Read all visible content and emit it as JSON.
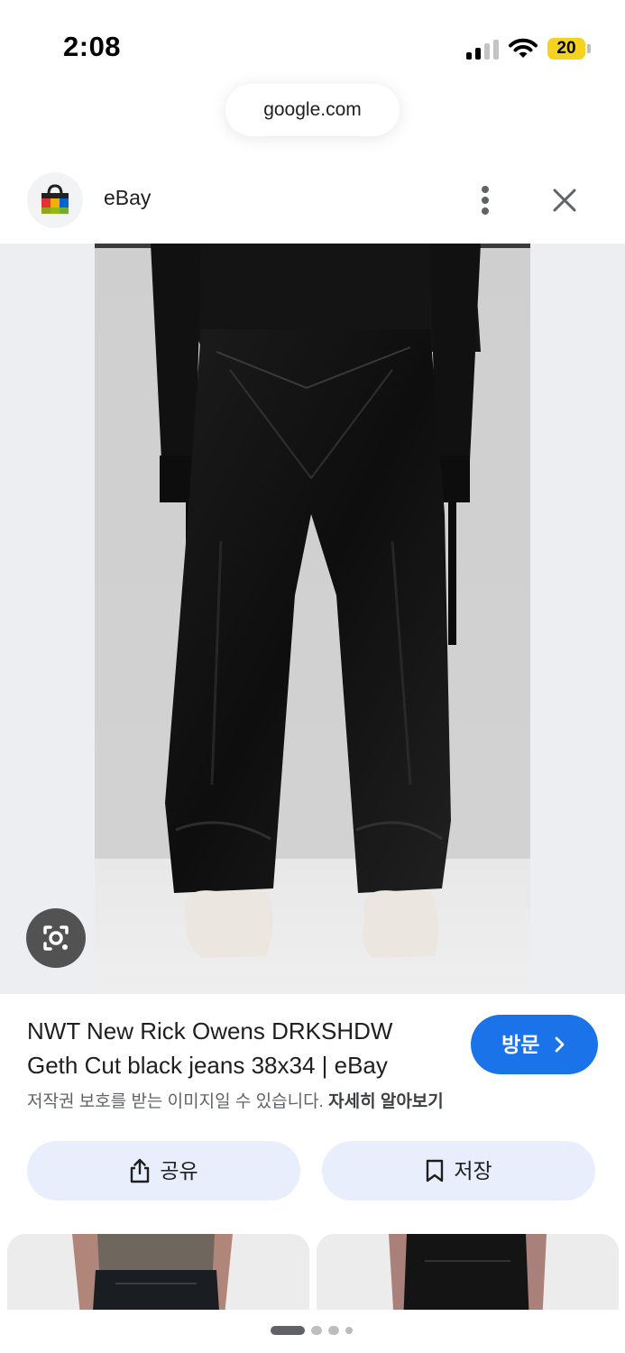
{
  "status_bar": {
    "time": "2:08",
    "battery": "20",
    "icons": [
      "cellular-signal-icon",
      "wifi-icon",
      "battery-icon"
    ]
  },
  "browser": {
    "url": "google.com"
  },
  "source": {
    "name": "eBay",
    "icons": [
      "ebay-logo-icon",
      "more-vert-icon",
      "close-icon"
    ]
  },
  "result": {
    "title": "NWT New Rick Owens DRKSHDW Geth Cut black jeans 38x34 | eBay",
    "visit_label": "방문",
    "copyright_notice": "저작권 보호를 받는 이미지일 수 있습니다.",
    "learn_more": "자세히 알아보기"
  },
  "actions": {
    "share_label": "공유",
    "save_label": "저장"
  },
  "pagination": {
    "dots": 4,
    "active": 1
  },
  "colors": {
    "accent": "#1a73e8",
    "action_button_bg": "#e8eefc",
    "image_bg": "#eceef1",
    "battery": "#f5d21f"
  }
}
